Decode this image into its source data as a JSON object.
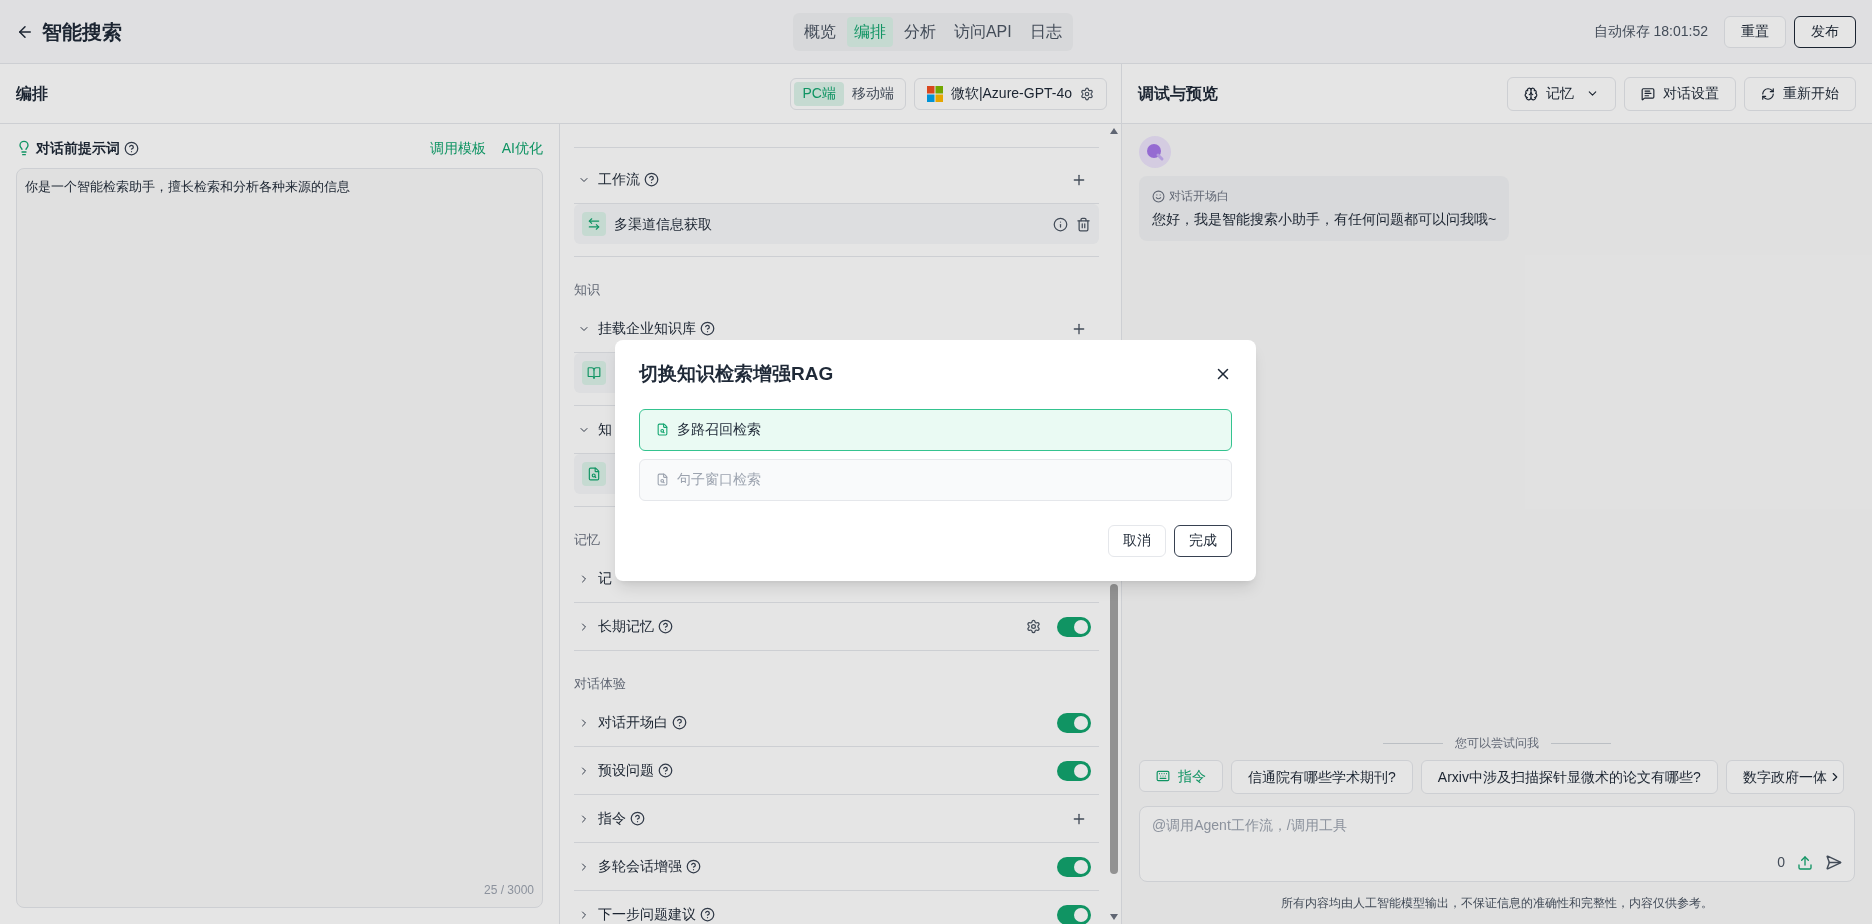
{
  "header": {
    "title": "智能搜索",
    "tabs": [
      {
        "label": "概览",
        "selected": false
      },
      {
        "label": "编排",
        "selected": true
      },
      {
        "label": "分析",
        "selected": false
      },
      {
        "label": "访问API",
        "selected": false
      },
      {
        "label": "日志",
        "selected": false
      }
    ],
    "autosave": "自动保存 18:01:52",
    "buttons": [
      {
        "label": "重置",
        "kind": "plain"
      },
      {
        "label": "发布",
        "kind": "outline"
      }
    ]
  },
  "editor": {
    "title": "编排",
    "platforms": [
      {
        "label": "PC端",
        "selected": true
      },
      {
        "label": "移动端",
        "selected": false
      }
    ],
    "model": "微软|Azure-GPT-4o"
  },
  "prompt": {
    "title": "对话前提示词",
    "actions": [
      "调用模板",
      "AI优化"
    ],
    "value": "你是一个智能检索助手，擅长检索和分析各种来源的信息",
    "counter": "25 / 3000"
  },
  "config": [
    {
      "kind": "group",
      "label": "工作流",
      "expanded": true,
      "help": true,
      "add": true
    },
    {
      "kind": "workflow",
      "label": "多渠道信息获取"
    },
    {
      "kind": "section",
      "label": "知识"
    },
    {
      "kind": "group",
      "label": "挂载企业知识库",
      "expanded": true,
      "help": true,
      "add": true
    },
    {
      "kind": "book"
    },
    {
      "kind": "group",
      "label": "知",
      "expanded": true
    },
    {
      "kind": "rag"
    },
    {
      "kind": "section",
      "label": "记忆"
    },
    {
      "kind": "group",
      "label": "记",
      "expanded": false
    },
    {
      "kind": "group",
      "label": "长期记忆",
      "expanded": false,
      "help": true,
      "settings": true,
      "on": true
    },
    {
      "kind": "section",
      "label": "对话体验"
    },
    {
      "kind": "group",
      "label": "对话开场白",
      "expanded": false,
      "help": true,
      "on": true
    },
    {
      "kind": "group",
      "label": "预设问题",
      "expanded": false,
      "help": true,
      "on": true
    },
    {
      "kind": "group",
      "label": "指令",
      "expanded": false,
      "help": true,
      "add": true
    },
    {
      "kind": "group",
      "label": "多轮会话增强",
      "expanded": false,
      "help": true,
      "on": true
    },
    {
      "kind": "group",
      "label": "下一步问题建议",
      "expanded": false,
      "help": true,
      "on": true
    }
  ],
  "preview": {
    "title": "调试与预览",
    "buttons": [
      {
        "label": "记忆",
        "kind": "memory"
      },
      {
        "label": "对话设置",
        "kind": "settings"
      },
      {
        "label": "重新开始",
        "kind": "restart"
      }
    ],
    "message": {
      "caption": "对话开场白",
      "text": "您好，我是智能搜索小助手，有任何问题都可以问我哦~"
    },
    "suggest_title": "您可以尝试问我",
    "chips": [
      {
        "label": "指令",
        "kind": "command"
      },
      {
        "label": "信通院有哪些学术期刊?",
        "kind": "question"
      },
      {
        "label": "Arxiv中涉及扫描探针显微术的论文有哪些?",
        "kind": "question"
      },
      {
        "label": "数字政府一体",
        "kind": "question"
      }
    ],
    "input": {
      "placeholder": "@调用Agent工作流，/调用工具",
      "count": "0"
    },
    "disclaimer": "所有内容均由人工智能模型输出，不保证信息的准确性和完整性，内容仅供参考。"
  },
  "dialog": {
    "title": "切换知识检索增强RAG",
    "options": [
      {
        "label": "多路召回检索",
        "selected": true
      },
      {
        "label": "句子窗口检索",
        "selected": false
      }
    ],
    "buttons": [
      {
        "label": "取消",
        "kind": "plain"
      },
      {
        "label": "完成",
        "kind": "primary"
      }
    ]
  }
}
